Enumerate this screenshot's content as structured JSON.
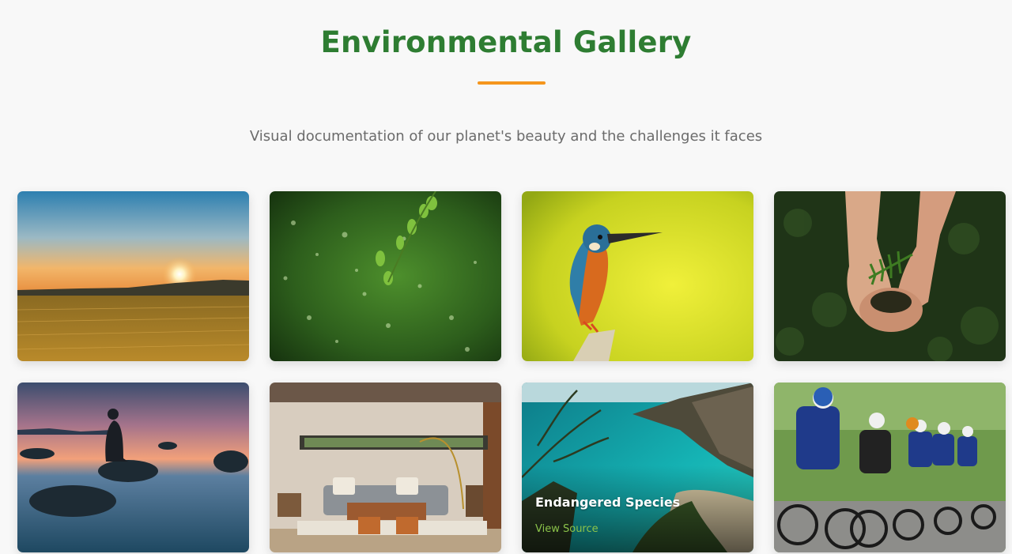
{
  "header": {
    "title": "Environmental Gallery",
    "subtitle": "Visual documentation of our planet's beauty and the challenges it faces"
  },
  "colors": {
    "title": "#2e7d32",
    "accent_underline": "#f5961d",
    "subtitle": "#6b6b6b",
    "link": "#8bc34a"
  },
  "gallery": {
    "items": [
      {
        "name": "sunset-wheat-field-photo",
        "hovered": false
      },
      {
        "name": "leaves-bokeh-rain-photo",
        "hovered": false
      },
      {
        "name": "kingfisher-bird-photo",
        "hovered": false
      },
      {
        "name": "hands-holding-plant-photo",
        "hovered": false
      },
      {
        "name": "person-on-rock-seascape-photo",
        "hovered": false
      },
      {
        "name": "modern-living-room-photo",
        "hovered": false
      },
      {
        "name": "turquoise-coastline-cliffs-photo",
        "hovered": true,
        "caption": "Endangered Species",
        "link_label": "View Source"
      },
      {
        "name": "cyclists-race-photo",
        "hovered": false
      }
    ]
  }
}
